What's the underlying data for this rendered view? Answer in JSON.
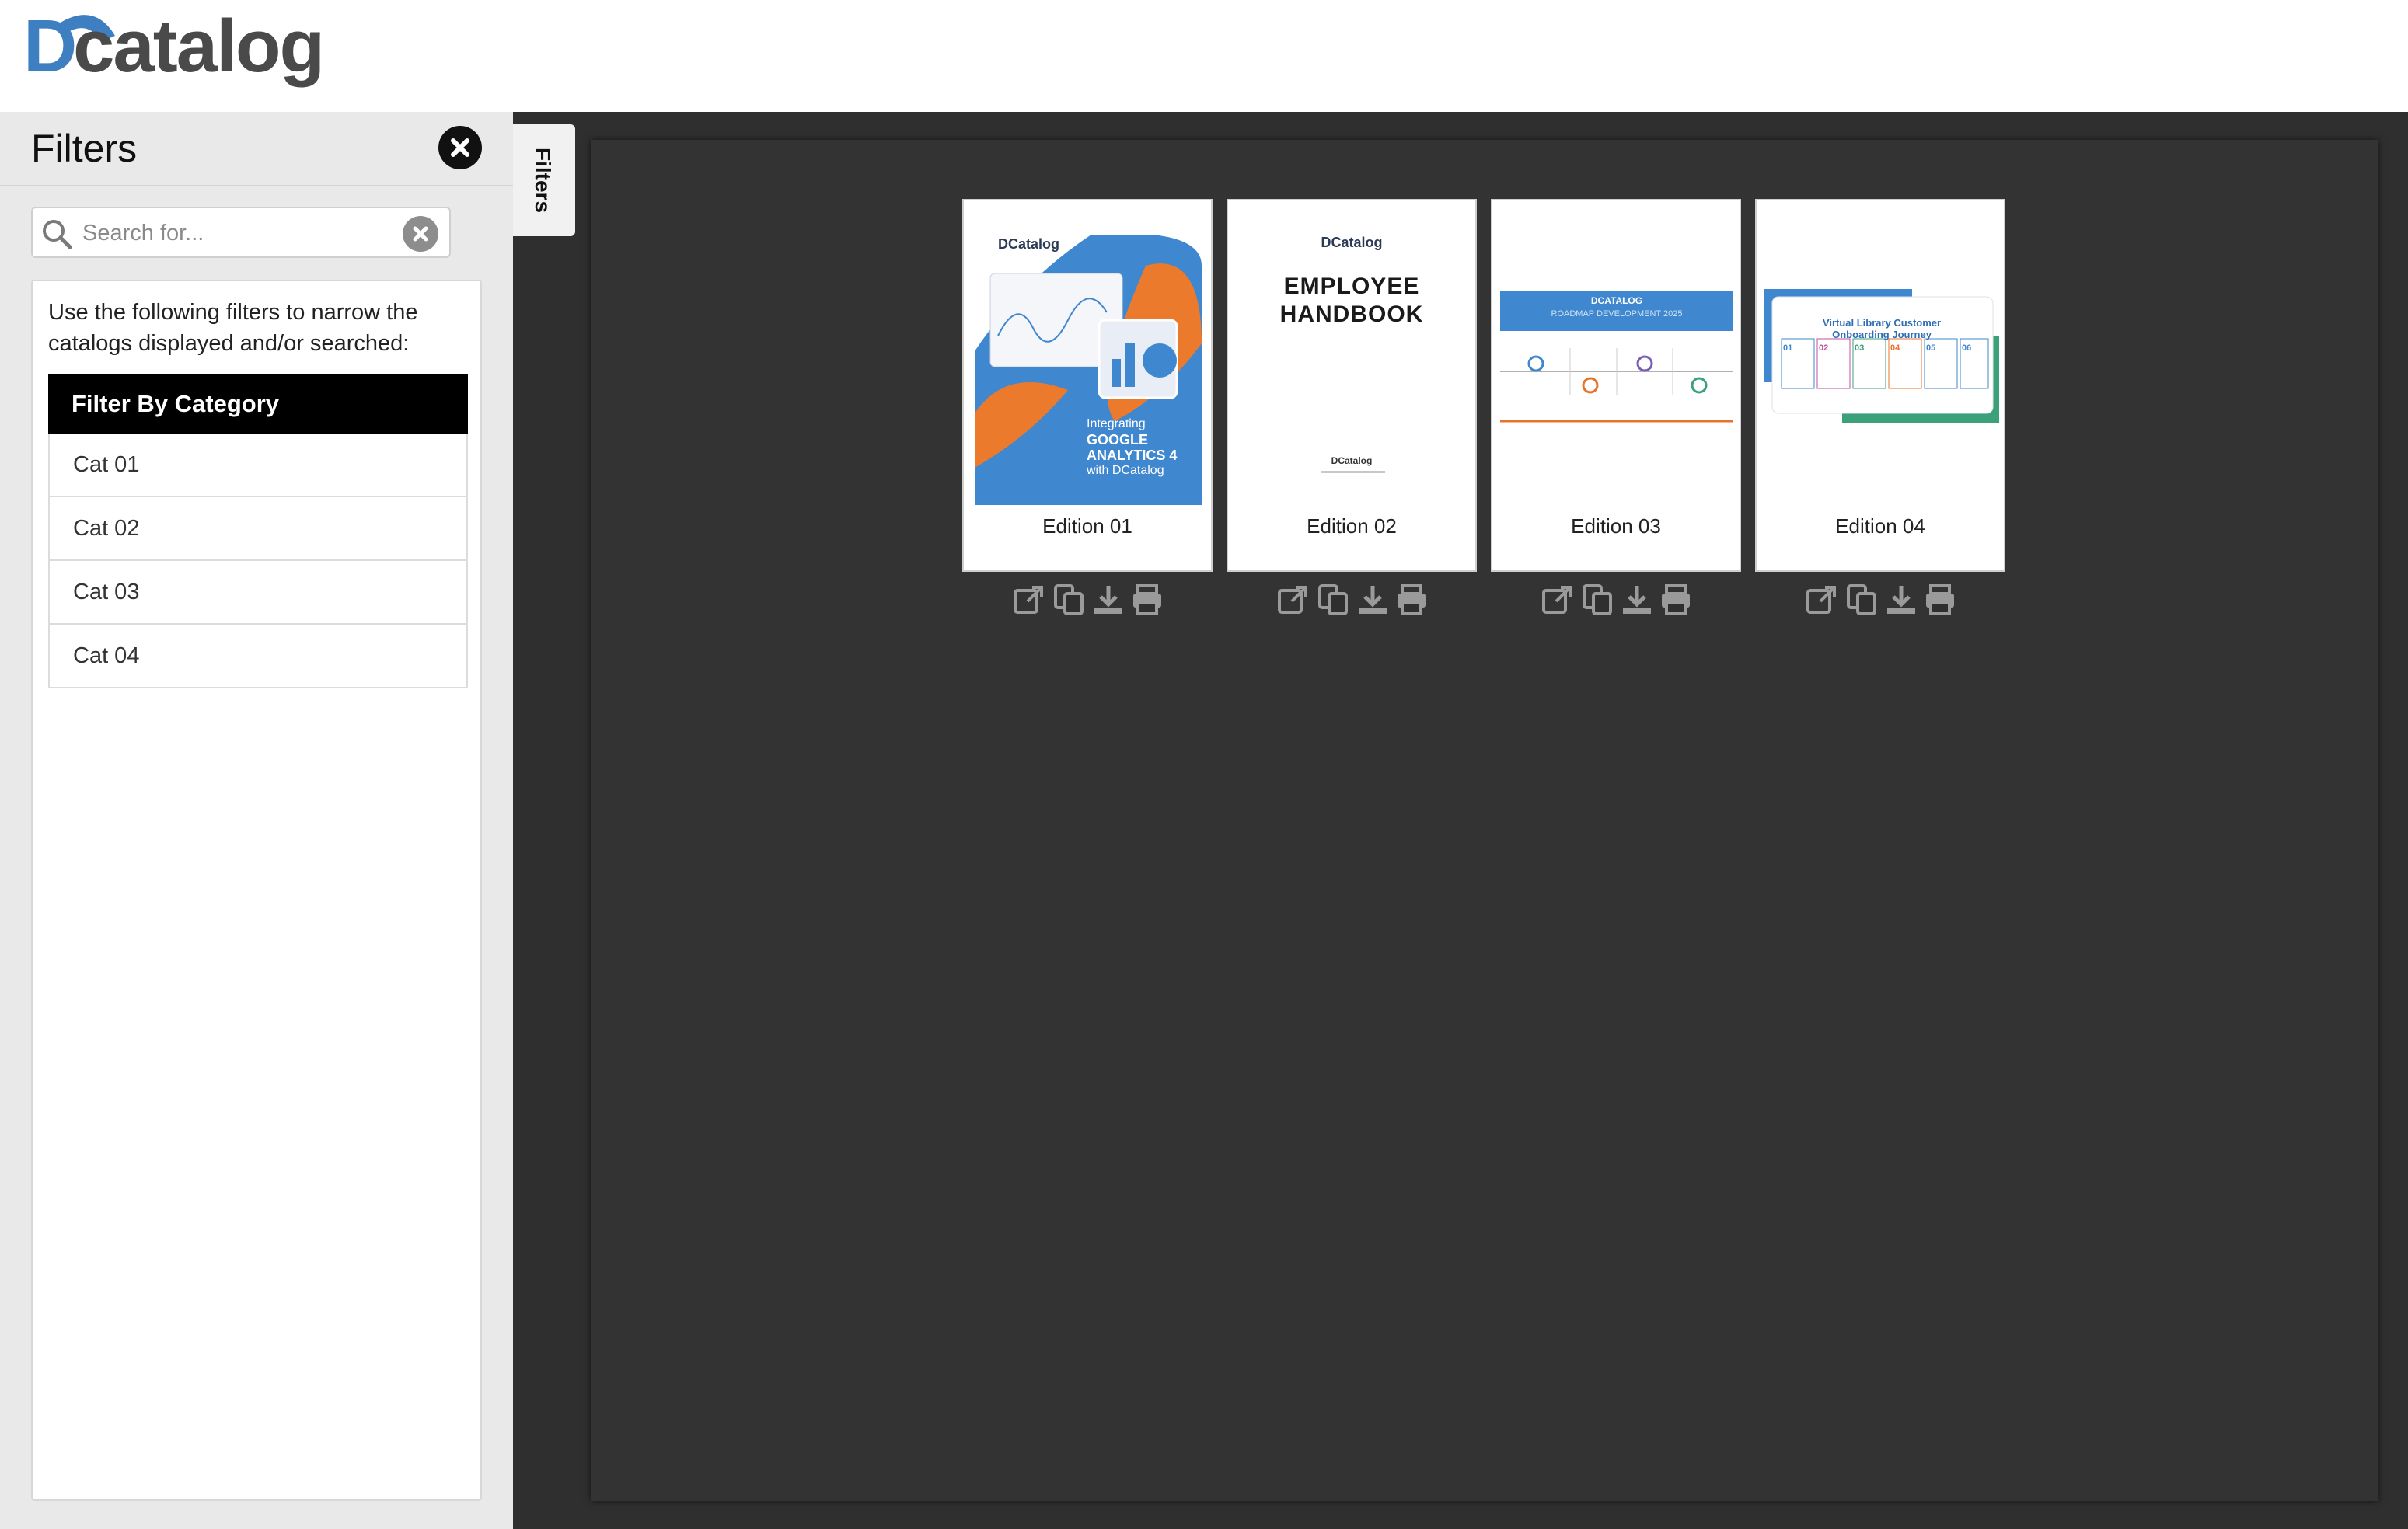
{
  "header": {
    "logo_text": "DCatalog",
    "logo_letter_d": "D",
    "logo_rest": "Catalog"
  },
  "filters": {
    "title": "Filters",
    "tab_label": "Filters",
    "search_placeholder": "Search for...",
    "intro": "Use the following filters to narrow the catalogs displayed and/or searched:",
    "category_header": "Filter By Category",
    "categories": [
      "Cat 01",
      "Cat 02",
      "Cat 03",
      "Cat 04"
    ]
  },
  "catalogs": [
    {
      "label": "Edition 01",
      "cover": {
        "brand": "DCatalog",
        "line1": "Integrating",
        "line2": "GOOGLE",
        "line3": "ANALYTICS 4",
        "line4": "with DCatalog"
      }
    },
    {
      "label": "Edition 02",
      "cover": {
        "brand": "DCatalog",
        "title1": "EMPLOYEE",
        "title2": "HANDBOOK",
        "footer_brand": "DCatalog"
      }
    },
    {
      "label": "Edition 03",
      "cover": {
        "heading": "DCATALOG",
        "subheading": "ROADMAP DEVELOPMENT 2025"
      }
    },
    {
      "label": "Edition 04",
      "cover": {
        "title1": "Virtual Library Customer",
        "title2": "Onboarding Journey",
        "steps": [
          "01",
          "02",
          "03",
          "04",
          "05",
          "06"
        ]
      }
    }
  ],
  "actions": [
    "open",
    "copy",
    "download",
    "print"
  ],
  "colors": {
    "accent_blue": "#3a7fc4",
    "accent_orange": "#e8732c",
    "dark_bg": "#2f2f2f"
  }
}
